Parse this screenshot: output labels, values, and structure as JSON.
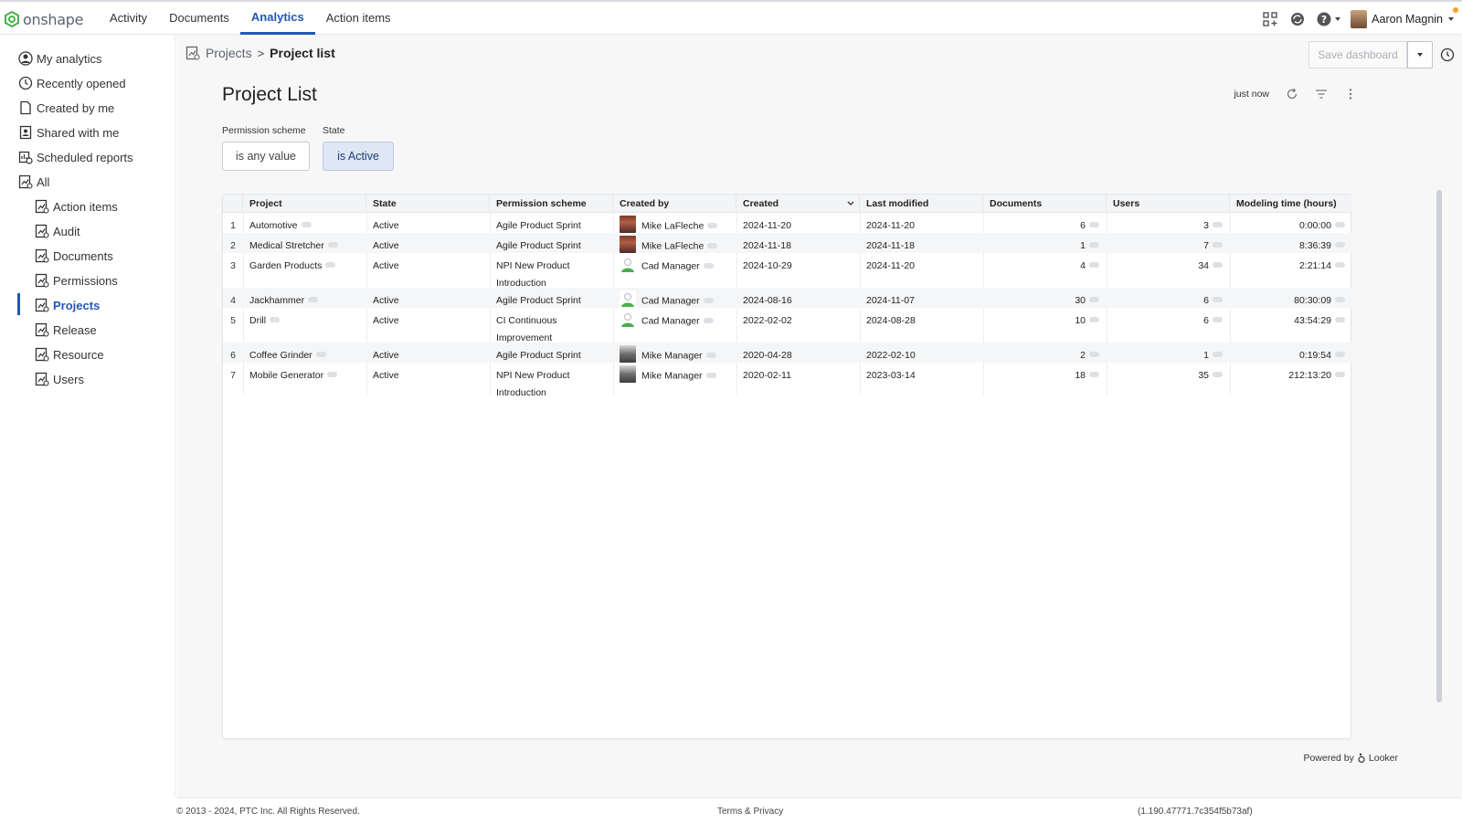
{
  "app": {
    "logo_text": "onshape",
    "nav": [
      {
        "label": "Activity",
        "active": false
      },
      {
        "label": "Documents",
        "active": false
      },
      {
        "label": "Analytics",
        "active": true
      },
      {
        "label": "Action items",
        "active": false
      }
    ],
    "user_name": "Aaron Magnin",
    "icons": [
      "apps-icon",
      "sync-icon",
      "help-icon"
    ]
  },
  "sidebar": {
    "items": [
      {
        "label": "My analytics",
        "icon": "user-circle-icon"
      },
      {
        "label": "Recently opened",
        "icon": "clock-icon"
      },
      {
        "label": "Created by me",
        "icon": "document-icon"
      },
      {
        "label": "Shared with me",
        "icon": "shared-user-icon"
      },
      {
        "label": "Scheduled reports",
        "icon": "scheduled-report-icon"
      },
      {
        "label": "All",
        "icon": "dashboard-icon"
      }
    ],
    "children": [
      {
        "label": "Action items",
        "active": false
      },
      {
        "label": "Audit",
        "active": false
      },
      {
        "label": "Documents",
        "active": false
      },
      {
        "label": "Permissions",
        "active": false
      },
      {
        "label": "Projects",
        "active": true
      },
      {
        "label": "Release",
        "active": false
      },
      {
        "label": "Resource",
        "active": false
      },
      {
        "label": "Users",
        "active": false
      }
    ]
  },
  "breadcrumb": {
    "parent": "Projects",
    "sep": ">",
    "current": "Project list"
  },
  "toolbar": {
    "save_label": "Save dashboard"
  },
  "dashboard": {
    "title": "Project List",
    "updated": "just now",
    "filters": [
      {
        "label": "Permission scheme",
        "value": "is any value"
      },
      {
        "label": "State",
        "value": "is Active"
      }
    ]
  },
  "table": {
    "columns": [
      "Project",
      "State",
      "Permission scheme",
      "Created by",
      "Created",
      "Last modified",
      "Documents",
      "Users",
      "Modeling time (hours)"
    ],
    "rows": [
      {
        "n": "1",
        "project": "Automotive",
        "state": "Active",
        "scheme": "Agile Product Sprint",
        "creator": "Mike LaFleche",
        "created": "2024-11-20",
        "modified": "2024-11-20",
        "docs": "6",
        "users": "3",
        "time": "0:00:00"
      },
      {
        "n": "2",
        "project": "Medical Stretcher",
        "state": "Active",
        "scheme": "Agile Product Sprint",
        "creator": "Mike LaFleche",
        "created": "2024-11-18",
        "modified": "2024-11-18",
        "docs": "1",
        "users": "7",
        "time": "8:36:39"
      },
      {
        "n": "3",
        "project": "Garden Products",
        "state": "Active",
        "scheme": "NPI New Product Introduction",
        "creator": "Cad Manager",
        "created": "2024-10-29",
        "modified": "2024-11-20",
        "docs": "4",
        "users": "34",
        "time": "2:21:14"
      },
      {
        "n": "4",
        "project": "Jackhammer",
        "state": "Active",
        "scheme": "Agile Product Sprint",
        "creator": "Cad Manager",
        "created": "2024-08-16",
        "modified": "2024-11-07",
        "docs": "30",
        "users": "6",
        "time": "80:30:09"
      },
      {
        "n": "5",
        "project": "Drill",
        "state": "Active",
        "scheme": "CI Continuous Improvement",
        "creator": "Cad Manager",
        "created": "2022-02-02",
        "modified": "2024-08-28",
        "docs": "10",
        "users": "6",
        "time": "43:54:29"
      },
      {
        "n": "6",
        "project": "Coffee Grinder",
        "state": "Active",
        "scheme": "Agile Product Sprint",
        "creator": "Mike Manager",
        "created": "2020-04-28",
        "modified": "2022-02-10",
        "docs": "2",
        "users": "1",
        "time": "0:19:54"
      },
      {
        "n": "7",
        "project": "Mobile Generator",
        "state": "Active",
        "scheme": "NPI New Product Introduction",
        "creator": "Mike Manager",
        "created": "2020-02-11",
        "modified": "2023-03-14",
        "docs": "18",
        "users": "35",
        "time": "212:13:20"
      }
    ]
  },
  "powered_by": "Powered by",
  "powered_brand": "Looker",
  "footer": {
    "copyright": "© 2013 - 2024, PTC Inc. All Rights Reserved.",
    "terms": "Terms & Privacy",
    "version": "(1.190.47771.7c354f5b73af)"
  },
  "colors": {
    "accent": "#2258b6",
    "chip_active_bg": "#dfe7f4"
  }
}
